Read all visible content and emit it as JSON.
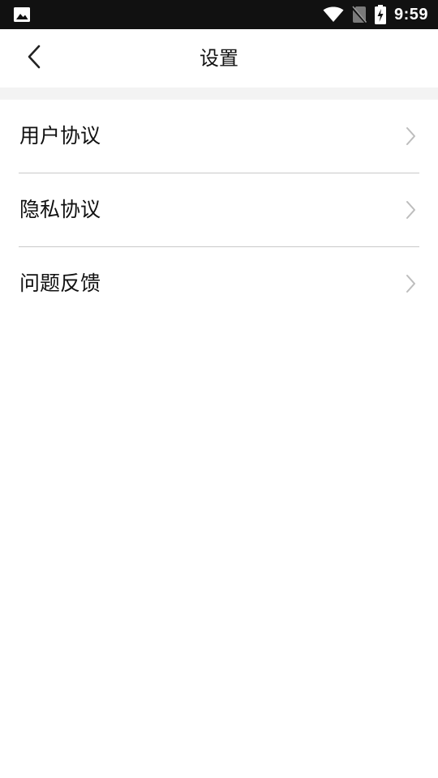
{
  "status_bar": {
    "time": "9:59",
    "icons": [
      "image-icon",
      "wifi-icon",
      "no-sim-icon",
      "battery-charging-icon"
    ],
    "background": "#111111"
  },
  "header": {
    "title": "设置",
    "back_icon": "chevron-left-icon"
  },
  "menu": {
    "items": [
      {
        "label": "用户协议",
        "icon": "chevron-right-icon"
      },
      {
        "label": "隐私协议",
        "icon": "chevron-right-icon"
      },
      {
        "label": "问题反馈",
        "icon": "chevron-right-icon"
      }
    ]
  },
  "colors": {
    "divider": "#c8c8c8",
    "section_gap": "#f3f3f3",
    "chevron": "#bdbdbd"
  }
}
